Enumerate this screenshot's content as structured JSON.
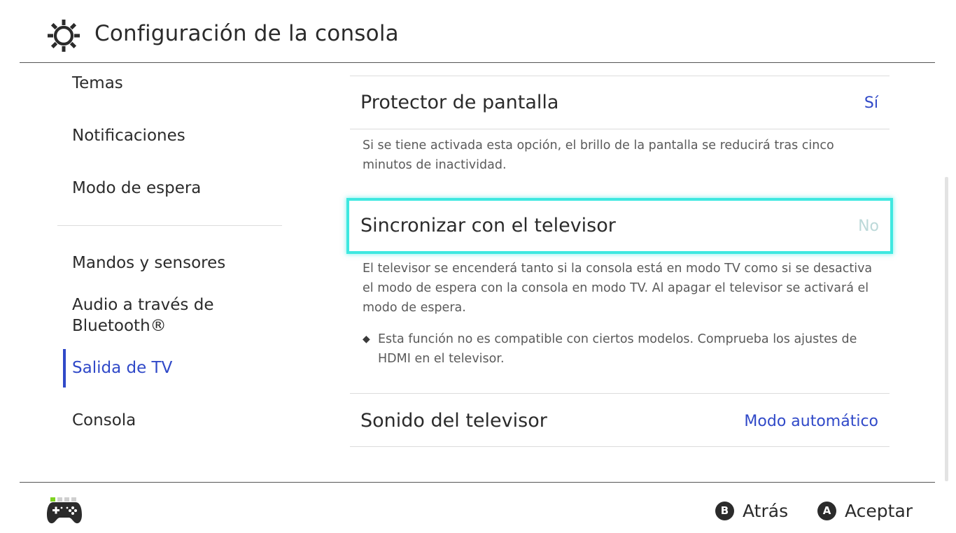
{
  "header": {
    "title": "Configuración de la consola",
    "icon": "gear-icon"
  },
  "sidebar": {
    "items": [
      {
        "label": "Temas"
      },
      {
        "label": "Notificaciones"
      },
      {
        "label": "Modo de espera"
      },
      {
        "label": "Mandos y sensores"
      },
      {
        "label": "Audio a través de Bluetooth®"
      },
      {
        "label": "Salida de TV",
        "active": true
      },
      {
        "label": "Consola"
      }
    ]
  },
  "settings": {
    "screensaver": {
      "label": "Protector de pantalla",
      "value": "Sí",
      "description": "Si se tiene activada esta opción, el brillo de la pantalla se reducirá tras cinco minutos de inactividad."
    },
    "tv_sync": {
      "label": "Sincronizar con el televisor",
      "value": "No",
      "description": "El televisor se encenderá tanto si la consola está en modo TV como si se desactiva el modo de espera con la consola en modo TV. Al apagar el televisor se activará el modo de espera.",
      "note": "Esta función no es compatible con ciertos modelos. Comprueba los ajustes de HDMI en el televisor."
    },
    "tv_sound": {
      "label": "Sonido del televisor",
      "value": "Modo automático"
    }
  },
  "footer": {
    "back": {
      "button": "B",
      "label": "Atrás"
    },
    "accept": {
      "button": "A",
      "label": "Aceptar"
    },
    "controller_icon": "gamepad-icon"
  },
  "colors": {
    "accent": "#3049c8",
    "focus": "#3ee8e0",
    "player_indicator": "#7ed321"
  }
}
